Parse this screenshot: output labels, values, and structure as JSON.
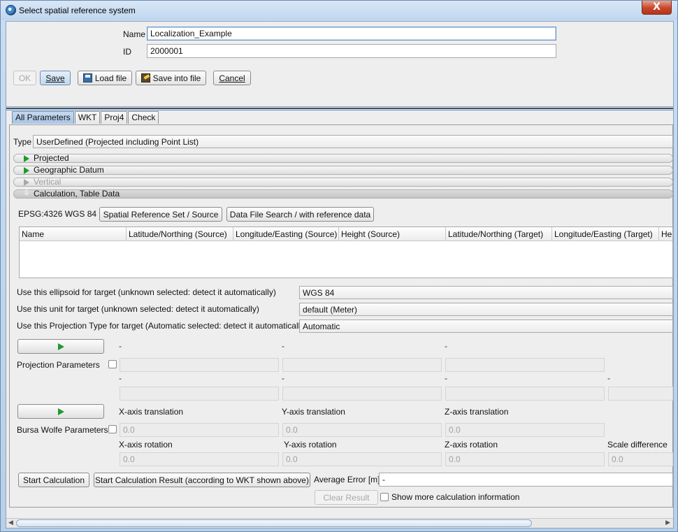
{
  "window": {
    "title": "Select spatial reference system",
    "close_glyph": "X"
  },
  "form": {
    "name_label": "Name",
    "name_value": "Localization_Example",
    "id_label": "ID",
    "id_value": "2000001"
  },
  "toolbar": {
    "ok": "OK",
    "save": "Save",
    "load_file": "Load file",
    "save_into_file": "Save into file",
    "cancel": "Cancel"
  },
  "tabs": [
    {
      "label": "All Parameters",
      "active": true
    },
    {
      "label": "WKT"
    },
    {
      "label": "Proj4"
    },
    {
      "label": "Check"
    }
  ],
  "type": {
    "label": "Type",
    "value": "UserDefined (Projected including Point List)"
  },
  "sections": {
    "projected": "Projected",
    "geographic_datum": "Geographic Datum",
    "vertical": "Vertical",
    "calculation": "Calculation, Table Data"
  },
  "calc": {
    "source_srs": "EPSG:4326 WGS 84",
    "spatial_ref_button": "Spatial Reference Set / Source",
    "data_file_search_button": "Data File Search / with reference data"
  },
  "table": {
    "columns": [
      "Name",
      "Latitude/Northing (Source)",
      "Longitude/Easting (Source)",
      "Height (Source)",
      "Latitude/Northing (Target)",
      "Longitude/Easting (Target)",
      "Hei"
    ]
  },
  "target_options": {
    "ellipsoid_label": "Use this ellipsoid for target (unknown selected: detect it automatically)",
    "ellipsoid_value": "WGS 84",
    "unit_label": "Use this unit for target (unknown selected: detect it automatically)",
    "unit_value": "default (Meter)",
    "projection_label": "Use this Projection Type for target (Automatic selected: detect it automatically)",
    "projection_value": "Automatic"
  },
  "projection_params": {
    "label": "Projection Parameters",
    "dash": "-"
  },
  "bursa_wolfe": {
    "label": "Bursa Wolfe Parameters",
    "x_translation": "X-axis translation",
    "y_translation": "Y-axis translation",
    "z_translation": "Z-axis translation",
    "x_rotation": "X-axis rotation",
    "y_rotation": "Y-axis rotation",
    "z_rotation": "Z-axis rotation",
    "scale_difference": "Scale difference",
    "value": "0.0"
  },
  "actions": {
    "start_calculation": "Start Calculation",
    "start_calculation_result": "Start Calculation Result (according to WKT shown above)",
    "average_error_label": "Average Error [m]",
    "average_error_value": "-",
    "clear_result": "Clear Result",
    "show_more_info": "Show more calculation information"
  },
  "colors": {
    "accent_green": "#1e9a2a",
    "title_bar": "#c0d6ee",
    "close_red": "#c7462c"
  }
}
